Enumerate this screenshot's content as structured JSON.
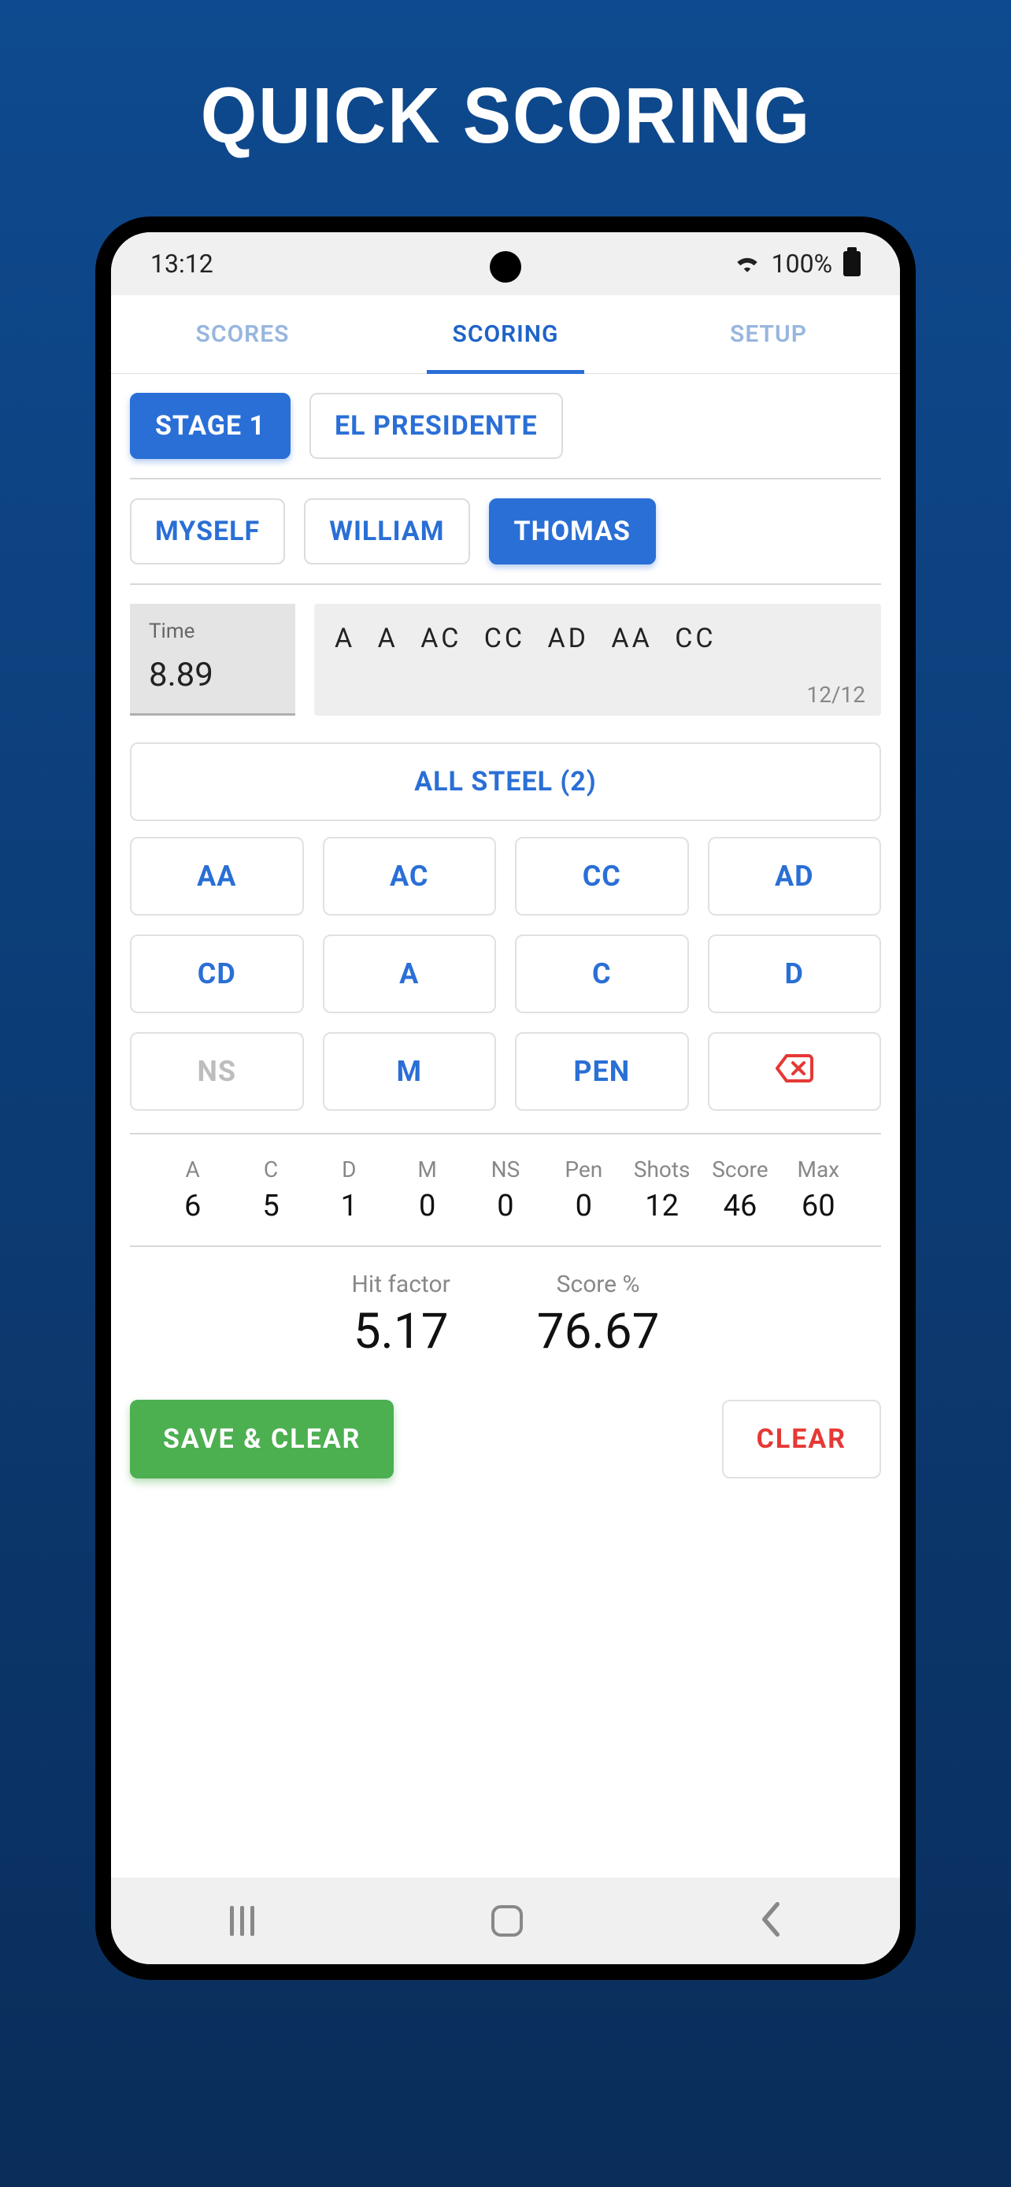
{
  "page_title": "QUICK SCORING",
  "status": {
    "time": "13:12",
    "battery": "100%"
  },
  "tabs": {
    "scores": "SCORES",
    "scoring": "SCORING",
    "setup": "SETUP"
  },
  "stage": {
    "label": "STAGE 1",
    "name": "EL PRESIDENTE"
  },
  "shooters": {
    "s0": "MYSELF",
    "s1": "WILLIAM",
    "s2": "THOMAS"
  },
  "time_box": {
    "label": "Time",
    "value": "8.89"
  },
  "hits": {
    "sequence": "A  A  AC  CC  AD  AA  CC",
    "count": "12/12"
  },
  "all_steel": "ALL STEEL (2)",
  "keys": {
    "aa": "AA",
    "ac": "AC",
    "cc": "CC",
    "ad": "AD",
    "cd": "CD",
    "a": "A",
    "c": "C",
    "d": "D",
    "ns": "NS",
    "m": "M",
    "pen": "PEN"
  },
  "stats": {
    "labels": {
      "a": "A",
      "c": "C",
      "d": "D",
      "m": "M",
      "ns": "NS",
      "pen": "Pen",
      "shots": "Shots",
      "score": "Score",
      "max": "Max"
    },
    "values": {
      "a": "6",
      "c": "5",
      "d": "1",
      "m": "0",
      "ns": "0",
      "pen": "0",
      "shots": "12",
      "score": "46",
      "max": "60"
    }
  },
  "factors": {
    "hit_label": "Hit factor",
    "hit_value": "5.17",
    "pct_label": "Score %",
    "pct_value": "76.67"
  },
  "actions": {
    "save": "SAVE & CLEAR",
    "clear": "CLEAR"
  }
}
